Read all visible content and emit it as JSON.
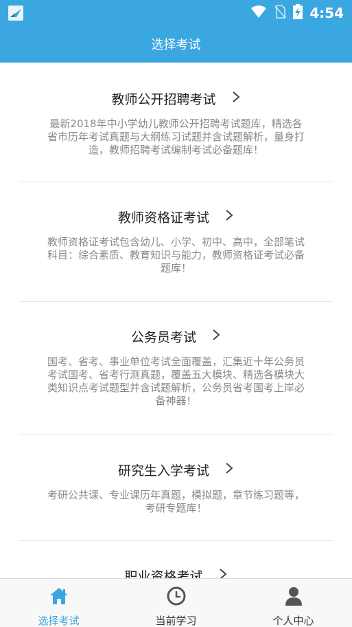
{
  "status_bar": {
    "time": "4:54"
  },
  "header": {
    "title": "选择考试"
  },
  "exams": [
    {
      "title": "教师公开招聘考试",
      "desc_lines": [
        "最新2018年中小学幼儿教师公开招聘考试题库，精选各",
        "省市历年考试真题与大纲练习试题并含试题解析，量身打",
        "造，教师招聘考试编制考试必备题库！"
      ]
    },
    {
      "title": "教师资格证考试",
      "desc_lines": [
        "教师资格证考试包含幼儿、小学、初中、高中，全部笔试",
        "科目：综合素质、教育知识与能力，教师资格证考试必备",
        "题库！"
      ]
    },
    {
      "title": "公务员考试",
      "desc_lines": [
        "国考、省考、事业单位考试全面覆盖，汇集近十年公务员",
        "考试国考、省考行测真题，覆盖五大模块、精选各模块大",
        "类知识点考试题型并含试题解析，公务员省考国考上岸必",
        "备神器！"
      ]
    },
    {
      "title": "研究生入学考试",
      "desc_lines": [
        "考研公共课、专业课历年真题，模拟题，章节练习题等，",
        "考研专题库！"
      ]
    },
    {
      "title": "职业资格考试",
      "desc_lines": []
    }
  ],
  "tabs": [
    {
      "label": "选择考试",
      "icon": "home-icon",
      "active": true
    },
    {
      "label": "当前学习",
      "icon": "clock-icon",
      "active": false
    },
    {
      "label": "个人中心",
      "icon": "person-icon",
      "active": false
    }
  ],
  "colors": {
    "primary": "#3aa7e0",
    "desc_text": "#8a8a8a",
    "title_text": "#222222",
    "tab_inactive_icon": "#555555"
  }
}
